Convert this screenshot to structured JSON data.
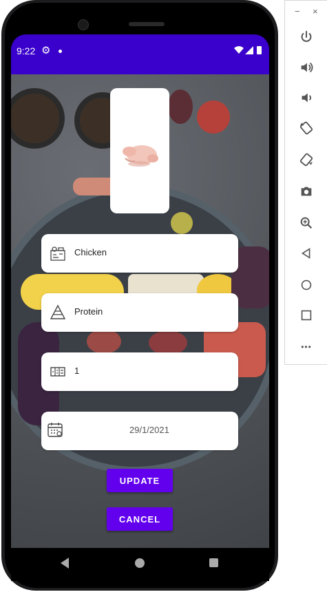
{
  "status_bar": {
    "time": "9:22",
    "color": "#3a00cc"
  },
  "window_controls": {
    "minimize": "−",
    "close": "×"
  },
  "side_toolbar": {
    "icons": [
      "power-icon",
      "volume-up-icon",
      "volume-down-icon",
      "rotate-left-icon",
      "rotate-right-icon",
      "camera-icon",
      "zoom-icon",
      "back-icon",
      "home-icon",
      "overview-icon",
      "more-icon"
    ]
  },
  "product": {
    "image_icon": "chicken-icon"
  },
  "form": {
    "name_value": "Chicken",
    "category_value": "Protein",
    "quantity_value": "1",
    "date_value": "29/1/2021"
  },
  "buttons": {
    "update_label": "UPDATE",
    "cancel_label": "CANCEL",
    "accent": "#6200ee"
  },
  "more_label": "•••"
}
